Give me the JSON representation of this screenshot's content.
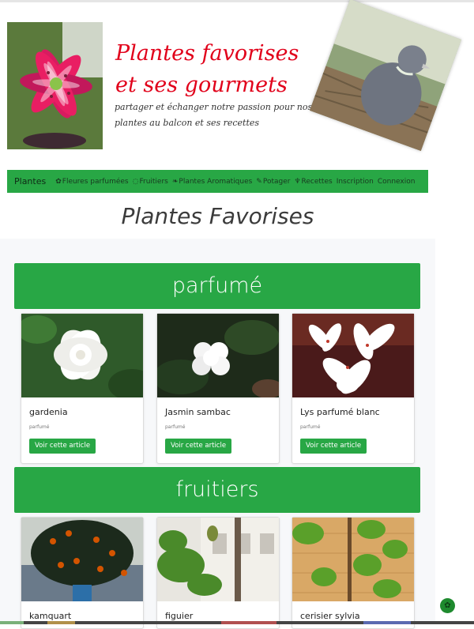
{
  "header": {
    "title": "Plantes favorises et ses gourmets",
    "subtitle": "partager et échanger notre passion pour nos plantes au balcon et ses recettes"
  },
  "nav": {
    "brand": "Plantes",
    "items": [
      {
        "label": "Fleures parfumées",
        "icon": "flower-icon"
      },
      {
        "label": "Fruitiers",
        "icon": "fruit-icon"
      },
      {
        "label": "Plantes Aromatiques",
        "icon": "leaf-icon"
      },
      {
        "label": "Potager",
        "icon": "carrot-icon"
      },
      {
        "label": "Recettes",
        "icon": "cutlery-icon"
      },
      {
        "label": "Inscription",
        "icon": ""
      },
      {
        "label": "Connexion",
        "icon": ""
      }
    ]
  },
  "page_heading": "Plantes Favorises",
  "categories": [
    {
      "title": "parfumé",
      "cards": [
        {
          "name": "gardenia",
          "tag": "parfumé",
          "button": "Voir cette article"
        },
        {
          "name": "Jasmin sambac",
          "tag": "parfumé",
          "button": "Voir cette article"
        },
        {
          "name": "Lys parfumé blanc",
          "tag": "parfumé",
          "button": "Voir cette article"
        }
      ]
    },
    {
      "title": "fruitiers",
      "cards": [
        {
          "name": "kamquart"
        },
        {
          "name": "figuier"
        },
        {
          "name": "cerisier sylvia"
        }
      ]
    }
  ],
  "colors": {
    "accent": "#28a745",
    "title_red": "#e1001a",
    "panel_bg": "#f7f8fa"
  }
}
